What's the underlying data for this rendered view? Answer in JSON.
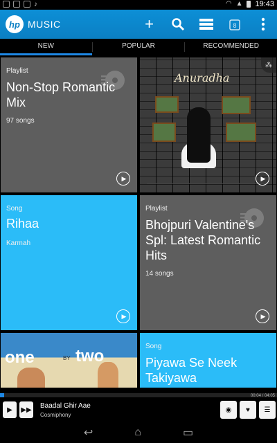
{
  "status": {
    "time": "19:43"
  },
  "app": {
    "logo_text": "hp",
    "title": "MUSIC",
    "actions": [
      {
        "label": "+",
        "icon": "add-icon"
      },
      {
        "label": "⚲",
        "icon": "search-icon"
      },
      {
        "label": "≡",
        "icon": "menu-icon"
      },
      {
        "label": "⛶",
        "icon": "store-icon"
      },
      {
        "label": "⋮",
        "icon": "overflow-icon"
      }
    ]
  },
  "tabs": [
    {
      "label": "NEW",
      "active": true
    },
    {
      "label": "POPULAR",
      "active": false
    },
    {
      "label": "RECOMMENDED",
      "active": false
    }
  ],
  "cards": [
    {
      "type": "Playlist",
      "title": "Non-Stop Romantic Mix",
      "sub": "97 songs",
      "color": "#5e5e5e"
    },
    {
      "type": "album-art",
      "art_title": "Anuradha",
      "color": "#111111"
    },
    {
      "type": "Song",
      "title": "Rihaa",
      "sub": "Karmah",
      "color": "#2bbcf8"
    },
    {
      "type": "Playlist",
      "title": "Bhojpuri Valentine's Spl: Latest Romantic Hits",
      "sub": "14 songs",
      "color": "#5e5e5e"
    },
    {
      "type": "album-art",
      "art_one": "one",
      "art_by": "BY",
      "art_two": "two",
      "color": "#3a89c9"
    },
    {
      "type": "Song",
      "title": "Piyawa Se Neek Takiyawa",
      "sub": "",
      "color": "#2bbcf8"
    }
  ],
  "player": {
    "track": "Baadal Ghir Aae",
    "artist": "Cosmiphony",
    "elapsed": "00:04",
    "duration": "04:05",
    "progress": 0.016
  }
}
